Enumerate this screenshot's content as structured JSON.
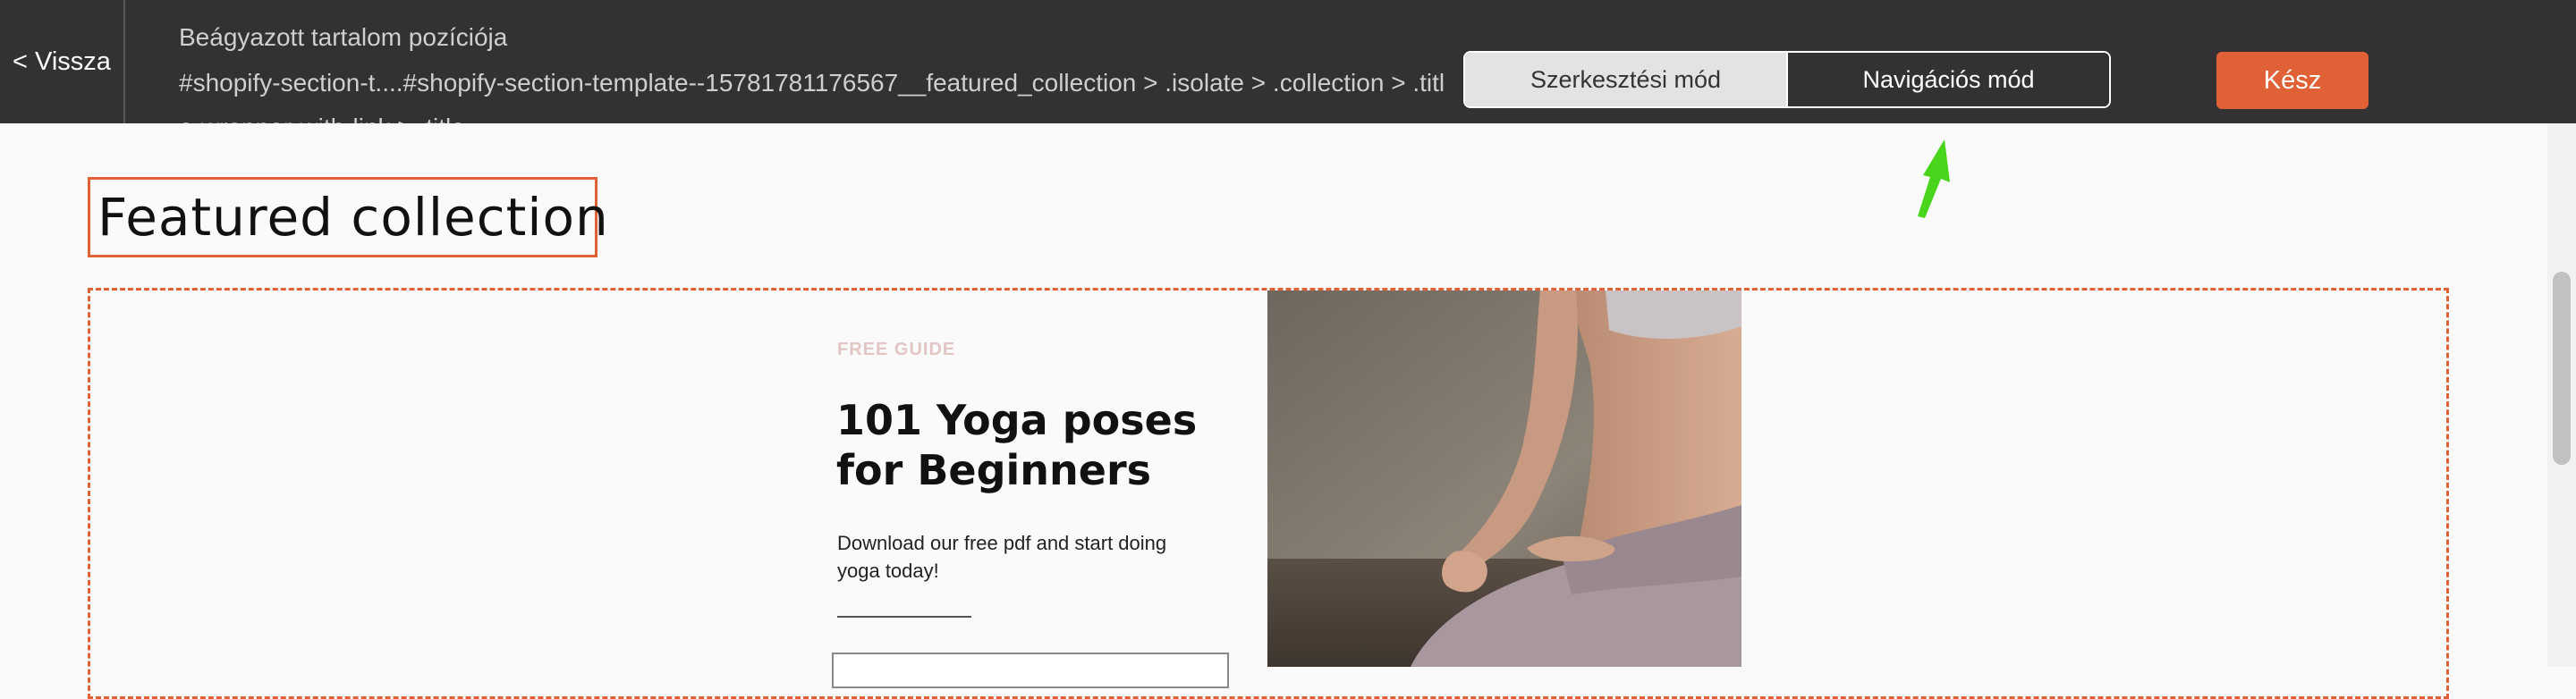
{
  "topbar": {
    "back_label": "< Vissza",
    "position_title": "Beágyazott tartalom pozíciója",
    "position_path": "#shopify-section-t....#shopify-section-template--15781781176567__featured_collection > .isolate > .collection > .title-wrapper-with-link > .title",
    "mode_edit_label": "Szerkesztési mód",
    "mode_nav_label": "Navigációs mód",
    "done_label": "Kész"
  },
  "content": {
    "collection_title": "Featured collection",
    "guide": {
      "eyebrow": "FREE GUIDE",
      "title": "101 Yoga poses for Beginners",
      "description": "Download our free pdf and start doing yoga today!"
    }
  },
  "colors": {
    "accent": "#df6135",
    "topbar_bg": "#333133",
    "cursor_arrow": "#48d51b"
  },
  "icons": {
    "cursor": "arrow-cursor-icon"
  }
}
